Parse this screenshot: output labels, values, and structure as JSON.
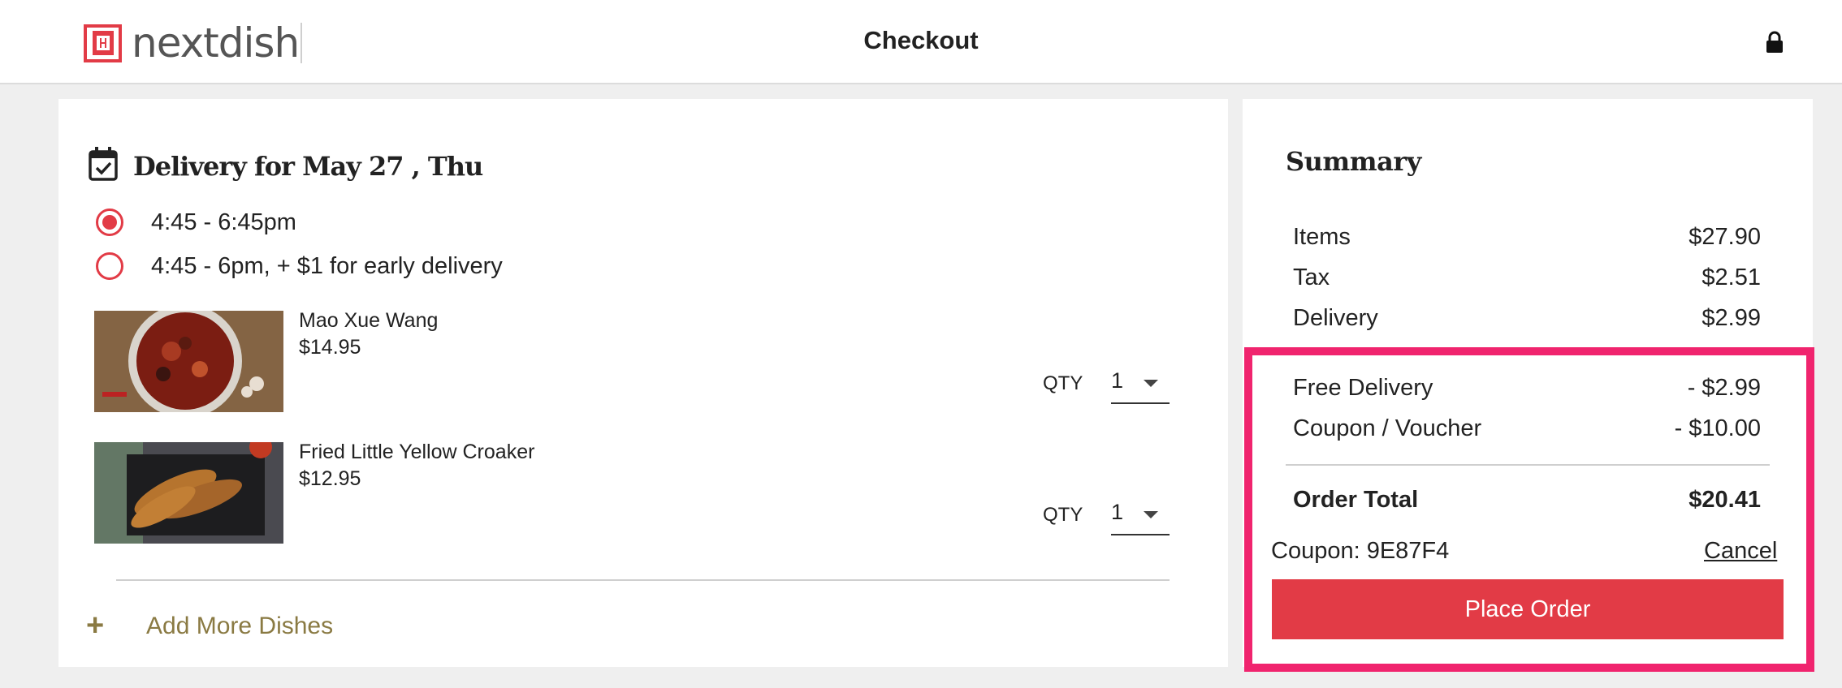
{
  "brand": {
    "name": "nextdish",
    "accent": "#e23b46"
  },
  "header": {
    "title": "Checkout",
    "lock_icon": "lock-icon"
  },
  "delivery": {
    "title": "Delivery for May 27 , Thu",
    "icon": "calendar-check-icon",
    "slots": [
      {
        "label": "4:45 - 6:45pm",
        "selected": true
      },
      {
        "label": "4:45 - 6pm, + $1 for early delivery",
        "selected": false
      }
    ]
  },
  "dishes": [
    {
      "name": "Mao Xue Wang",
      "price": "$14.95",
      "qty_label": "QTY",
      "qty": "1"
    },
    {
      "name": "Fried Little Yellow Croaker",
      "price": "$12.95",
      "qty_label": "QTY",
      "qty": "1"
    }
  ],
  "add_more": {
    "icon": "plus-icon",
    "label": "Add More Dishes"
  },
  "summary": {
    "title": "Summary",
    "lines": [
      {
        "label": "Items",
        "value": "$27.90"
      },
      {
        "label": "Tax",
        "value": "$2.51"
      },
      {
        "label": "Delivery",
        "value": "$2.99"
      }
    ],
    "discounts": [
      {
        "label": "Free Delivery",
        "value": "- $2.99"
      },
      {
        "label": "Coupon / Voucher",
        "value": "- $10.00"
      }
    ],
    "total": {
      "label": "Order Total",
      "value": "$20.41"
    },
    "coupon_text": "Coupon: 9E87F4",
    "cancel_label": "Cancel",
    "place_order_label": "Place Order",
    "highlight_color": "#f0246e"
  }
}
